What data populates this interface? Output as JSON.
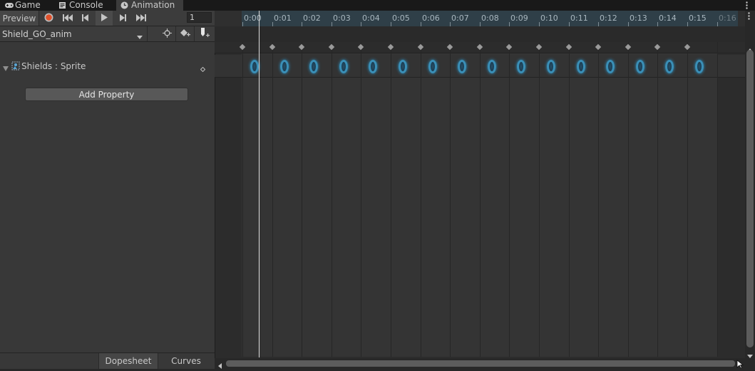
{
  "tabs": [
    {
      "label": "Game",
      "icon": "gamepad-icon"
    },
    {
      "label": "Console",
      "icon": "console-icon"
    },
    {
      "label": "Animation",
      "icon": "clock-icon",
      "active": true
    }
  ],
  "toolbar": {
    "preview_label": "Preview",
    "frame_value": "1",
    "clip_name": "Shield_GO_anim"
  },
  "property": {
    "label": "Shields : Sprite"
  },
  "add_property_label": "Add Property",
  "bottom_tabs": {
    "dopesheet": "Dopesheet",
    "curves": "Curves"
  },
  "ruler_ticks": [
    "0:00",
    "0:01",
    "0:02",
    "0:03",
    "0:04",
    "0:05",
    "0:06",
    "0:07",
    "0:08",
    "0:09",
    "0:10",
    "0:11",
    "0:12",
    "0:13",
    "0:14",
    "0:15",
    "0:16"
  ],
  "keyframe_count": 16,
  "colors": {
    "record": "#e0502a",
    "sprite_glow": "#3a8fb7",
    "ruler_highlight": "#2f3f48"
  }
}
